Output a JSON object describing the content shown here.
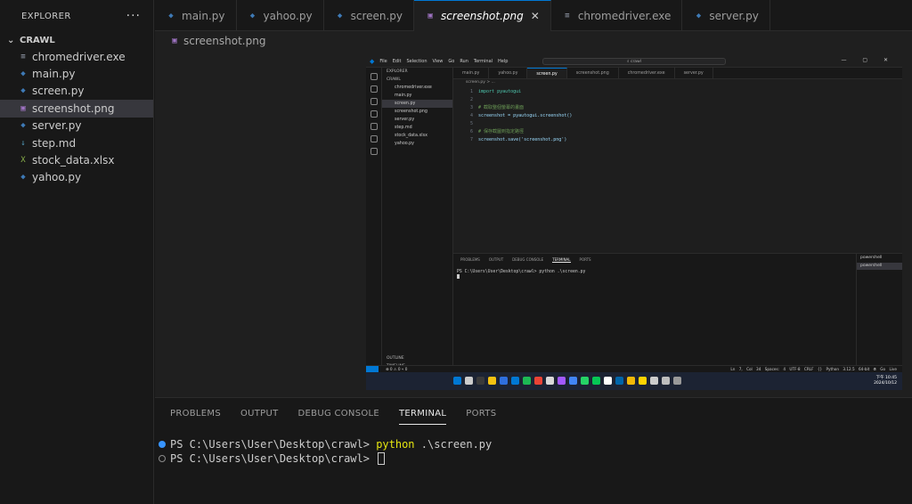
{
  "sidebar": {
    "title": "EXPLORER",
    "folder": "CRAWL",
    "files": [
      {
        "name": "chromedriver.exe",
        "icon": "file-lines-icon",
        "color": "#9da5b4"
      },
      {
        "name": "main.py",
        "icon": "python-icon",
        "color": "#3e7ab6"
      },
      {
        "name": "screen.py",
        "icon": "python-icon",
        "color": "#3e7ab6"
      },
      {
        "name": "screenshot.png",
        "icon": "image-icon",
        "color": "#a074c4",
        "selected": true
      },
      {
        "name": "server.py",
        "icon": "python-icon",
        "color": "#3e7ab6"
      },
      {
        "name": "step.md",
        "icon": "markdown-icon",
        "color": "#519aba"
      },
      {
        "name": "stock_data.xlsx",
        "icon": "excel-icon",
        "color": "#89b04a"
      },
      {
        "name": "yahoo.py",
        "icon": "python-icon",
        "color": "#3e7ab6"
      }
    ]
  },
  "tabs": [
    {
      "label": "main.py"
    },
    {
      "label": "yahoo.py"
    },
    {
      "label": "screen.py"
    },
    {
      "label": "screenshot.png",
      "active": true
    },
    {
      "label": "chromedriver.exe"
    },
    {
      "label": "server.py"
    }
  ],
  "breadcrumb": "screenshot.png",
  "panel": {
    "tabs": [
      "PROBLEMS",
      "OUTPUT",
      "DEBUG CONSOLE",
      "TERMINAL",
      "PORTS"
    ],
    "active": "TERMINAL",
    "lines": [
      {
        "prompt": "PS C:\\Users\\User\\Desktop\\crawl> ",
        "cmd": "python",
        "args": " .\\screen.py"
      },
      {
        "prompt": "PS C:\\Users\\User\\Desktop\\crawl> "
      }
    ]
  },
  "screenshot": {
    "menu": [
      "File",
      "Edit",
      "Selection",
      "View",
      "Go",
      "Run",
      "Terminal",
      "Help"
    ],
    "search": "crawl",
    "explorer_title": "EXPLORER",
    "folder": "CRAWL",
    "files": [
      "chromedriver.exe",
      "main.py",
      "screen.py",
      "screenshot.png",
      "server.py",
      "step.md",
      "stock_data.xlsx",
      "yahoo.py"
    ],
    "tabs": [
      "main.py",
      "yahoo.py",
      "screen.py",
      "screenshot.png",
      "chromedriver.exe",
      "server.py"
    ],
    "breadcrumb": "screen.py > ...",
    "code": [
      {
        "n": "1",
        "t": "import pyautogui"
      },
      {
        "n": "2",
        "t": ""
      },
      {
        "n": "3",
        "t": "# 截取整個螢幕的畫面"
      },
      {
        "n": "4",
        "t": "screenshot = pyautogui.screenshot()"
      },
      {
        "n": "5",
        "t": ""
      },
      {
        "n": "6",
        "t": "# 保存截圖到指定路徑"
      },
      {
        "n": "7",
        "t": "screenshot.save('screenshot.png')"
      }
    ],
    "panel_tabs": [
      "PROBLEMS",
      "OUTPUT",
      "DEBUG CONSOLE",
      "TERMINAL",
      "PORTS"
    ],
    "terminal": "PS C:\\Users\\User\\Desktop\\crawl> python .\\screen.py",
    "terminal_list": [
      "powershell",
      "powershell"
    ],
    "outline": "OUTLINE",
    "timeline": "TIMELINE",
    "status_left": "⊗ 0 ⚠ 0   ⑂ 0",
    "status_right": "Ln 7, Col 34  Spaces: 4  UTF-8  CRLF  {} Python  3.12.5 64-bit  ⦾ Go Live",
    "clock_time": "下午 10:45",
    "clock_date": "2024/10/12"
  }
}
